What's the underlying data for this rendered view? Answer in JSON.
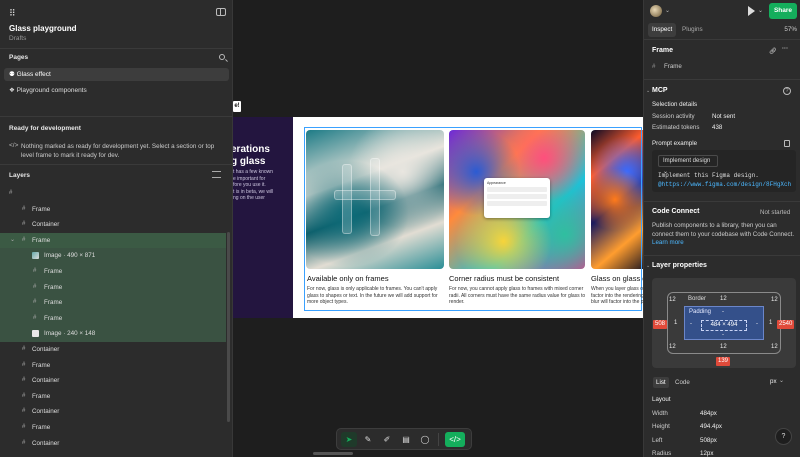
{
  "file": {
    "name": "Glass playground",
    "location": "Drafts"
  },
  "pages": {
    "title": "Pages",
    "items": [
      {
        "label": "Glass effect"
      },
      {
        "label": "❖ Playground components"
      }
    ]
  },
  "ready": {
    "title": "Ready for development",
    "message": "Nothing marked as ready for development yet. Select a section or top level frame to mark it ready for dev."
  },
  "layers": {
    "title": "Layers",
    "items": [
      {
        "label": "Frame"
      },
      {
        "label": "Container"
      },
      {
        "label": "Frame"
      },
      {
        "label": "Image · 490 × 871"
      },
      {
        "label": "Frame"
      },
      {
        "label": "Frame"
      },
      {
        "label": "Frame"
      },
      {
        "label": "Frame"
      },
      {
        "label": "Image · 240 × 148"
      },
      {
        "label": "Container"
      },
      {
        "label": "Frame"
      },
      {
        "label": "Container"
      },
      {
        "label": "Frame"
      },
      {
        "label": "Container"
      },
      {
        "label": "Frame"
      },
      {
        "label": "Container"
      }
    ]
  },
  "canvas": {
    "heading_partial": "erations\ng glass",
    "intro_partial": "t has a few known\ne important for\nfore you use it.\nt is in beta, we will\nng on the user",
    "bubble": "e!",
    "cards": [
      {
        "title": "Available only on frames",
        "desc": "For now, glass is only applicable to frames. You can't apply glass to shapes or text. In the future we will add support for more object types."
      },
      {
        "title": "Corner radius must be consistent",
        "desc": "For now, you cannot apply glass to frames with mixed corner radii. All corners must have the same radius value for glass to render."
      },
      {
        "title": "Glass on glass do",
        "desc": "When you layer glass on factor into the rendering blur will factor into the p"
      }
    ],
    "mini_panel_title": "Appearance"
  },
  "toolbar": {
    "tools": [
      "move",
      "pen",
      "pencil",
      "comment-text",
      "comment",
      "dev-mode"
    ]
  },
  "inspect": {
    "zoom": "57%",
    "share": "Share",
    "tabs": [
      "Inspect",
      "Plugins"
    ],
    "selection_title": "Frame",
    "selection_sub": "Frame",
    "mcp": {
      "title": "MCP",
      "details_title": "Selection details",
      "session_label": "Session activity",
      "session_value": "Not sent",
      "tokens_label": "Estimated tokens",
      "tokens_value": "438",
      "prompt_label": "Prompt example",
      "dropdown": "Implement design",
      "code_line1": "Implement this Figma design.",
      "code_line2": "@https://www.figma.com/design/8FHgXchl..."
    },
    "code_connect": {
      "title": "Code Connect",
      "status": "Not started",
      "text": "Publish components to a library, then you can connect them to your codebase with Code Connect.",
      "link": "Learn more"
    },
    "layer_props": {
      "title": "Layer properties",
      "border_label": "Border",
      "padding_label": "Padding",
      "size": "484 × 494",
      "radius_tl": "12",
      "radius_tr": "12",
      "radius_bl": "12",
      "radius_br": "12",
      "border_top": "12",
      "border_left": "1",
      "border_right": "1",
      "border_bottom": "12",
      "pad_left": "-",
      "pad_right": "-",
      "pad_top": "-",
      "pad_bottom": "-",
      "margin_left": "508",
      "margin_right": "2540",
      "margin_bottom": "139"
    },
    "view_tabs": [
      "List",
      "Code"
    ],
    "unit": "px",
    "layout": {
      "title": "Layout",
      "rows": [
        {
          "label": "Width",
          "value": "484px"
        },
        {
          "label": "Height",
          "value": "494.4px"
        },
        {
          "label": "Left",
          "value": "508px"
        },
        {
          "label": "Radius",
          "value": "12px"
        }
      ]
    },
    "help": "?"
  }
}
